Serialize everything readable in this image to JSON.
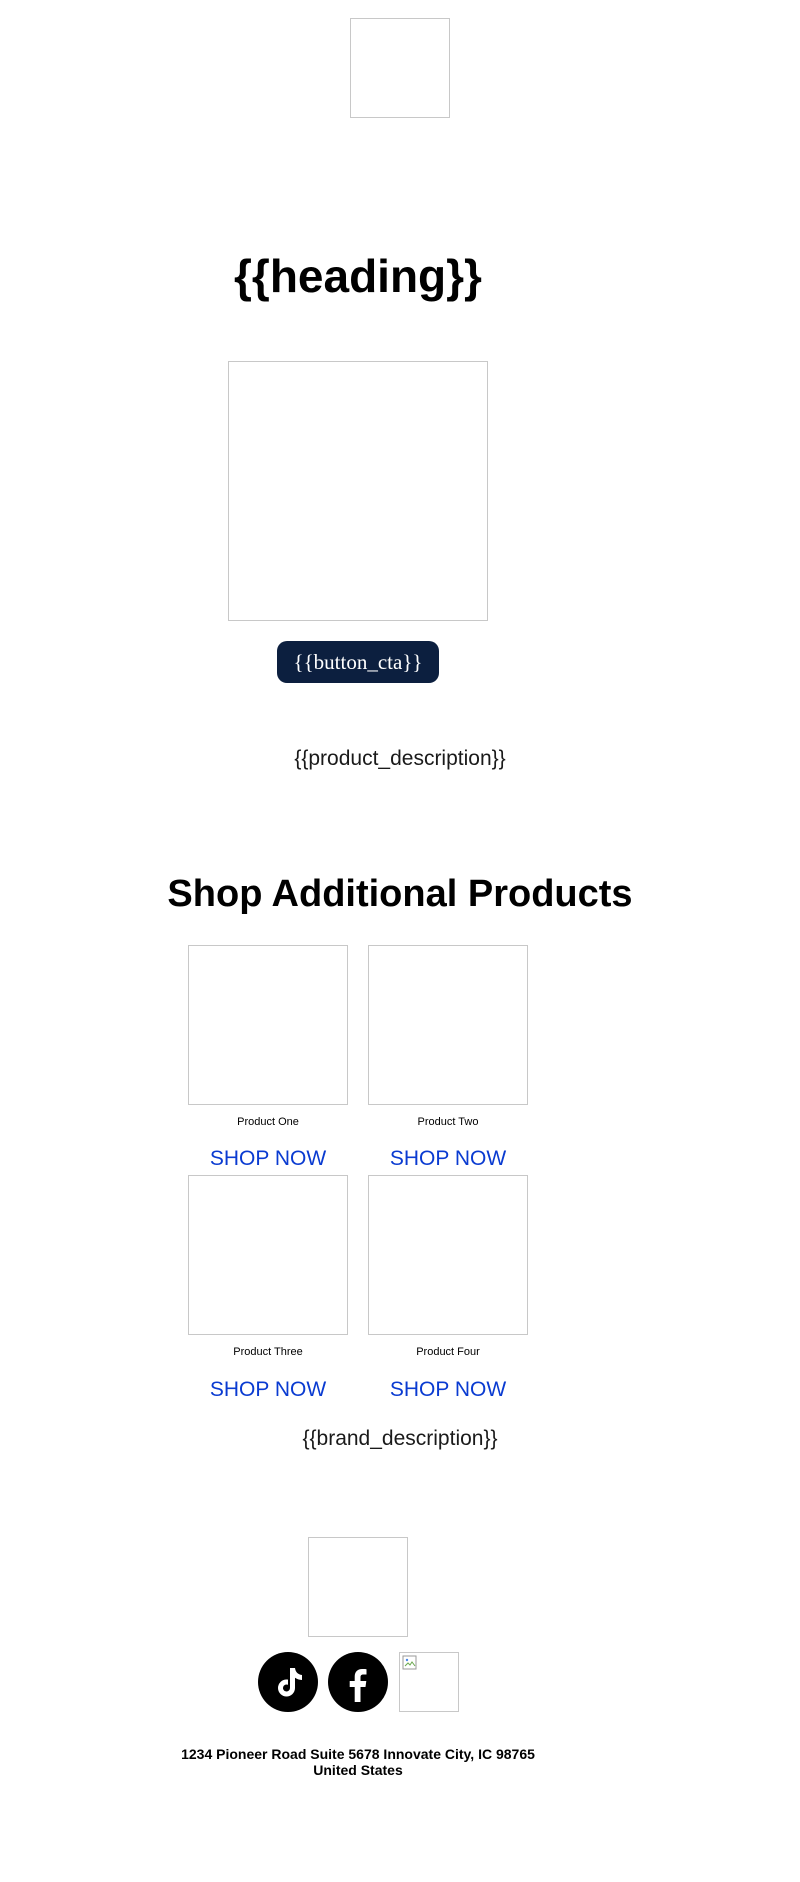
{
  "email": {
    "heading": "{{heading}}",
    "button_cta": "{{button_cta}}",
    "product_description": "{{product_description}}",
    "shop_section_title": "Shop Additional Products",
    "products": [
      {
        "name": "Product One",
        "link_label": "SHOP NOW"
      },
      {
        "name": "Product Two",
        "link_label": "SHOP NOW"
      },
      {
        "name": "Product Three",
        "link_label": "SHOP NOW"
      },
      {
        "name": "Product Four",
        "link_label": "SHOP NOW"
      }
    ],
    "brand_description": "{{brand_description}}",
    "social": [
      {
        "icon": "tiktok-icon"
      },
      {
        "icon": "facebook-icon"
      },
      {
        "icon": "broken-image-icon"
      }
    ],
    "address_line1": "1234 Pioneer Road Suite 5678 Innovate City, IC 98765",
    "address_line2": "United States"
  },
  "colors": {
    "cta_background": "#0c1f3f",
    "link": "#0a3bd1",
    "placeholder_border": "#c8c8c8"
  }
}
